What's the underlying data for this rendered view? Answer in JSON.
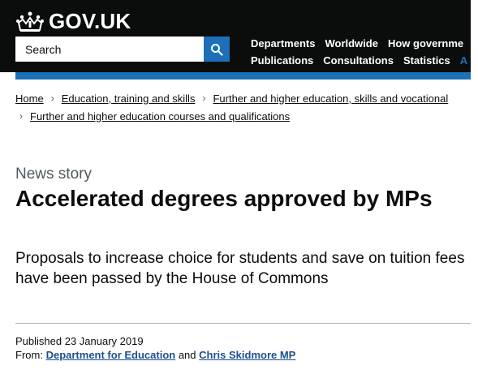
{
  "header": {
    "logo_text": "GOV.UK",
    "search_placeholder": "Search",
    "nav_row1": [
      "Departments",
      "Worldwide",
      "How governme"
    ],
    "nav_row2": [
      "Publications",
      "Consultations",
      "Statistics",
      "A"
    ],
    "colors": {
      "header_bg": "#0b0c0c",
      "blue": "#1d70b8"
    }
  },
  "breadcrumbs": {
    "line1": [
      "Home",
      "Education, training and skills",
      "Further and higher education, skills and vocational"
    ],
    "line2": [
      "Further and higher education courses and qualifications"
    ]
  },
  "article": {
    "label": "News story",
    "title": "Accelerated degrees approved by MPs",
    "summary": "Proposals to increase choice for students and save on tuition fees have been passed by the House of Commons",
    "published_prefix": "Published",
    "published_date": "23 January 2019",
    "from_prefix": "From:",
    "from_link1": "Department for Education",
    "and_text": "and",
    "from_link2": "Chris Skidmore MP"
  }
}
